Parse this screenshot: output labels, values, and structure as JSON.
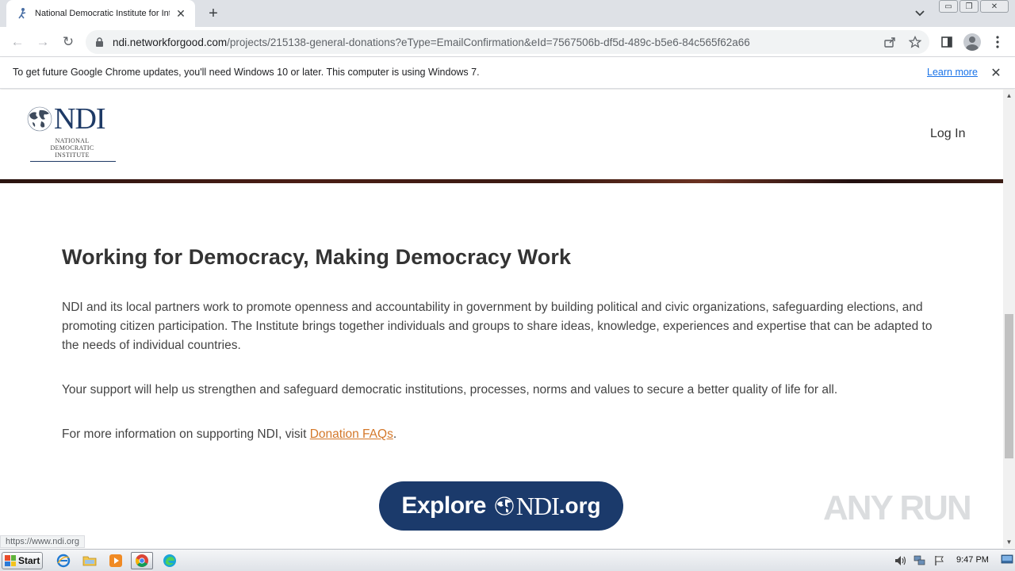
{
  "browser": {
    "tab": {
      "title": "National Democratic Institute for International Affairs",
      "close_glyph": "✕"
    },
    "new_tab_glyph": "+",
    "tab_search_glyph": "⌄",
    "window_controls": {
      "minimize": "▭",
      "restore": "❐",
      "close": "✕"
    },
    "nav": {
      "back": "←",
      "forward": "→",
      "reload": "↻"
    },
    "url": {
      "domain": "ndi.networkforgood.com",
      "path": "/projects/215138-general-donations?eType=EmailConfirmation&eId=7567506b-df5d-489c-b5e6-84c565f62a66"
    },
    "toolbar_icons": [
      "share-icon",
      "bookmark-star-icon",
      "side-panel-icon",
      "profile-avatar-icon",
      "kebab-menu-icon"
    ]
  },
  "infobar": {
    "message": "To get future Google Chrome updates, you'll need Windows 10 or later. This computer is using Windows 7.",
    "link": "Learn more",
    "close_glyph": "✕"
  },
  "site": {
    "logo": {
      "wordmark": "NDI",
      "sub_line1": "NATIONAL",
      "sub_line2": "DEMOCRATIC",
      "sub_line3": "INSTITUTE"
    },
    "login": "Log In"
  },
  "content": {
    "headline": "Working for Democracy, Making Democracy Work",
    "paragraph1": "NDI and its local partners work to promote openness and accountability in government by building political and civic organizations, safeguarding elections, and promoting citizen participation. The Institute brings together individuals and groups to share ideas, knowledge, experiences and expertise that can be adapted to the needs of individual countries.",
    "paragraph2": "Your support will help us strengthen and safeguard democratic institutions, processes, norms and values to secure a better quality of life for all.",
    "paragraph3_prefix": "For more information on supporting NDI, visit ",
    "paragraph3_link": "Donation FAQs",
    "paragraph3_suffix": ".",
    "explore_banner": {
      "explore": "Explore",
      "ndi": "NDI",
      "org": ".org"
    }
  },
  "watermark": {
    "text": "ANY RUN"
  },
  "status_bar": {
    "url": "https://www.ndi.org"
  },
  "taskbar": {
    "start_label": "Start",
    "clock": "9:47 PM"
  },
  "colors": {
    "ndi_navy": "#1b3a6b",
    "link_orange": "#d4782a",
    "chrome_link_blue": "#1a73e8"
  }
}
